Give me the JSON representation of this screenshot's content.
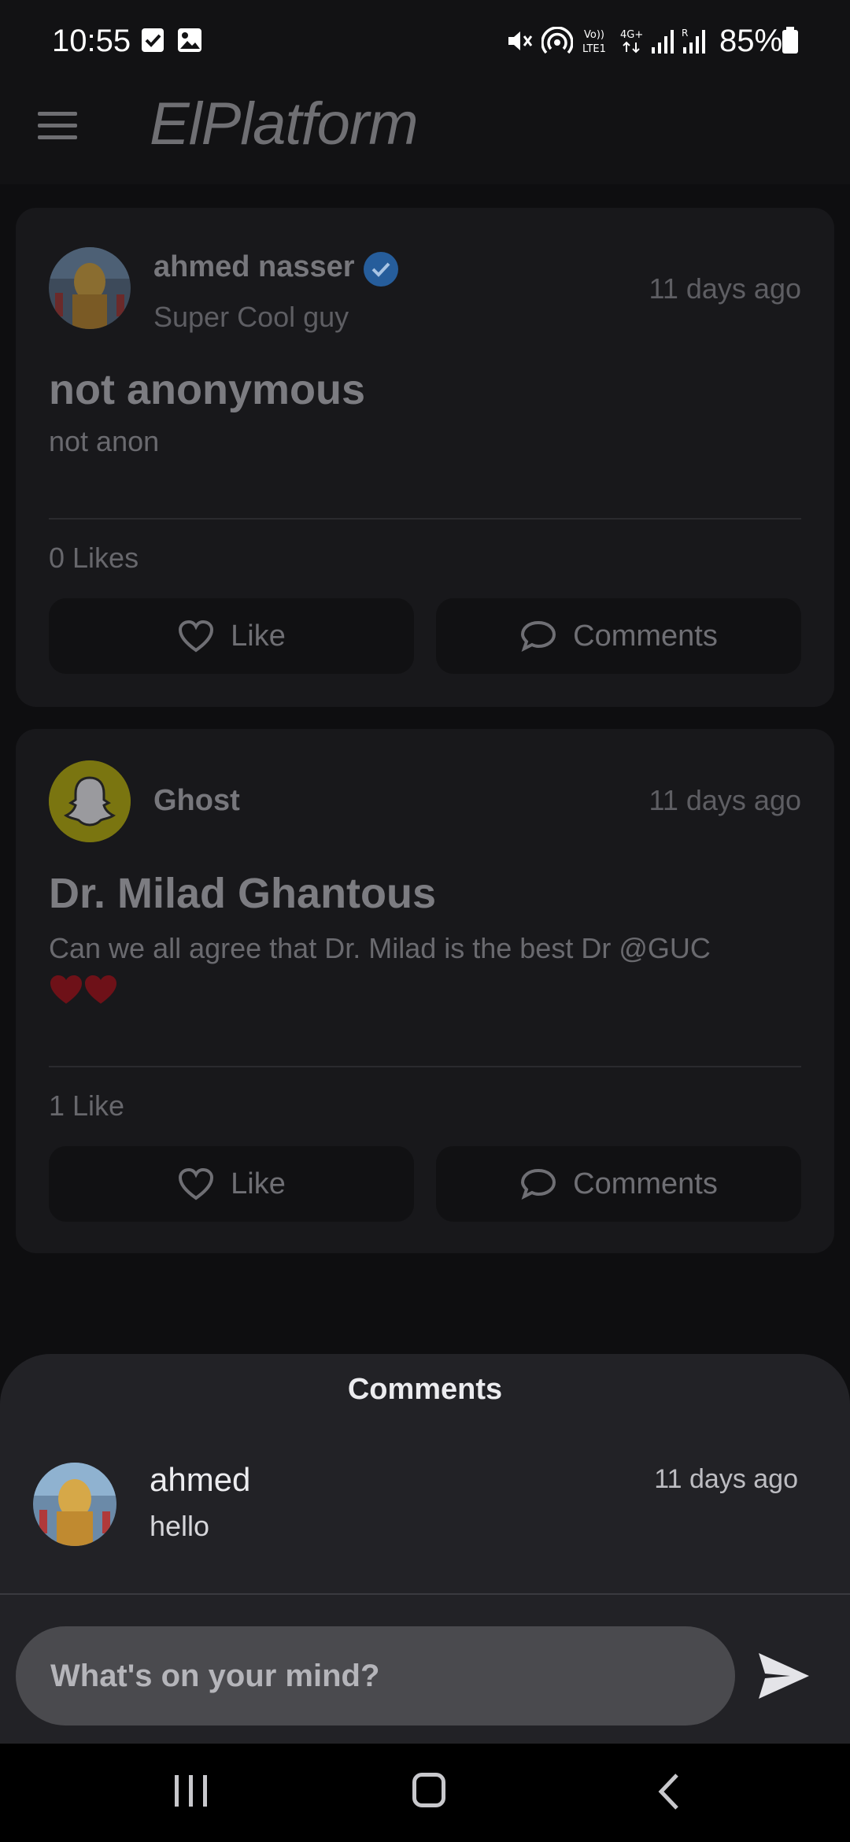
{
  "status_bar": {
    "time": "10:55",
    "battery": "85%"
  },
  "app_bar": {
    "title": "ElPlatform"
  },
  "posts": [
    {
      "author": "ahmed nasser",
      "verified": true,
      "subtitle": "Super Cool guy",
      "time": "11 days ago",
      "title": "not anonymous",
      "body": "not anon",
      "likes": "0 Likes",
      "like_label": "Like",
      "comments_label": "Comments"
    },
    {
      "author": "Ghost",
      "time": "11 days ago",
      "title": "Dr. Milad Ghantous",
      "body": "Can we all agree that Dr. Milad is the best Dr @GUC",
      "body_emoji": "❤️❤️",
      "likes": "1 Like",
      "like_label": "Like",
      "comments_label": "Comments"
    }
  ],
  "comments_sheet": {
    "title": "Comments",
    "comments": [
      {
        "author": "ahmed",
        "text": "hello",
        "time": "11 days ago"
      }
    ],
    "input_placeholder": "What's on your mind?"
  },
  "colors": {
    "verified": "#2f7fd6",
    "ghost_avatar_bg": "#c8c218",
    "heart": "#c0202a"
  }
}
